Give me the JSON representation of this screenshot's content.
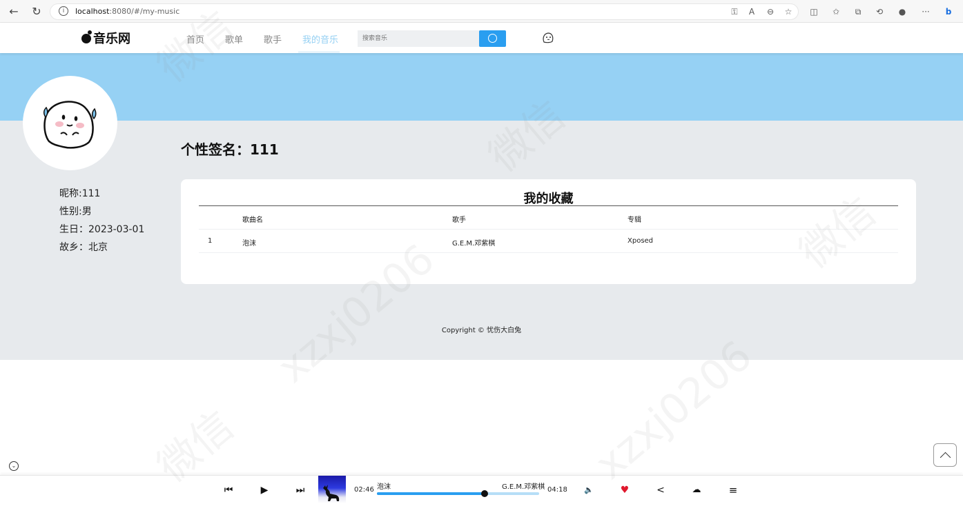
{
  "browser": {
    "url_host": "localhost",
    "url_rest": ":8080/#/my-music"
  },
  "header": {
    "logo": "音乐网",
    "nav": [
      "首页",
      "歌单",
      "歌手",
      "我的音乐"
    ],
    "active_nav": "我的音乐",
    "search_placeholder": "搜索音乐"
  },
  "profile": {
    "nickname": "昵称:111",
    "gender": "性别:男",
    "birthday": "生日：2023-03-01",
    "hometown": "故乡：北京",
    "signature": "个性签名：111"
  },
  "favorites": {
    "title": "我的收藏",
    "columns": [
      "歌曲名",
      "歌手",
      "专辑"
    ],
    "rows": [
      {
        "index": "1",
        "name": "泡沫",
        "singer": "G.E.M.邓紫棋",
        "album": "Xposed"
      }
    ]
  },
  "footer": {
    "copyright": "Copyright © 忧伤大白兔"
  },
  "player": {
    "song": "泡沫",
    "singer": "G.E.M.邓紫棋",
    "current_time": "02:46",
    "total_time": "04:18",
    "progress": 0.665
  },
  "colors": {
    "banner": "#96d1f4",
    "accent": "#2a9ef0",
    "active_nav": "#95d0f3",
    "heart": "#e0182d"
  },
  "watermark": [
    "微信",
    "xzxj0206"
  ]
}
